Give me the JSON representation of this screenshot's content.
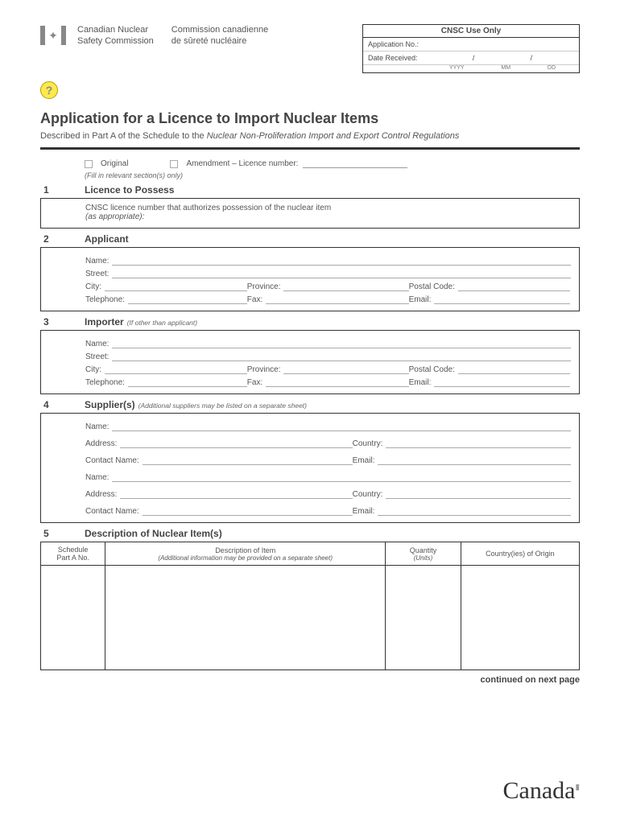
{
  "header": {
    "org_en_1": "Canadian Nuclear",
    "org_en_2": "Safety Commission",
    "org_fr_1": "Commission canadienne",
    "org_fr_2": "de sûreté nucléaire",
    "cnsc_box_title": "CNSC Use Only",
    "app_no_label": "Application No.:",
    "date_rcv_label": "Date Received:",
    "date_sep": "/",
    "yyyy": "YYYY",
    "mm": "MM",
    "dd": "DD",
    "help": "?"
  },
  "title": "Application for a Licence to Import Nuclear Items",
  "subtitle_pre": "Described in Part A of the Schedule to the ",
  "subtitle_em": "Nuclear Non-Proliferation Import and Export Control Regulations",
  "options": {
    "original": "Original",
    "amendment": "Amendment – Licence number:",
    "fillnote": "(Fill in relevant section(s) only)"
  },
  "sections": {
    "s1": {
      "num": "1",
      "title": "Licence to Possess",
      "text": "CNSC licence number that authorizes possession of the nuclear item",
      "note": "(as appropriate):"
    },
    "s2": {
      "num": "2",
      "title": "Applicant"
    },
    "s3": {
      "num": "3",
      "title": "Importer",
      "note": "(If other than applicant)"
    },
    "s4": {
      "num": "4",
      "title": "Supplier(s)",
      "note": "(Additional suppliers may be listed on a separate sheet)"
    },
    "s5": {
      "num": "5",
      "title": "Description of Nuclear Item(s)"
    }
  },
  "fields": {
    "name": "Name:",
    "street": "Street:",
    "city": "City:",
    "province": "Province:",
    "postal": "Postal Code:",
    "tel": "Telephone:",
    "fax": "Fax:",
    "email": "Email:",
    "address": "Address:",
    "country": "Country:",
    "contact": "Contact Name:"
  },
  "table": {
    "h1a": "Schedule",
    "h1b": "Part A No.",
    "h2": "Description of Item",
    "h2sub": "(Additional information may be provided on a separate sheet)",
    "h3": "Quantity",
    "h3sub": "(Units)",
    "h4": "Country(ies) of Origin"
  },
  "footer": {
    "continued": "continued on next page",
    "wordmark": "Canada"
  }
}
